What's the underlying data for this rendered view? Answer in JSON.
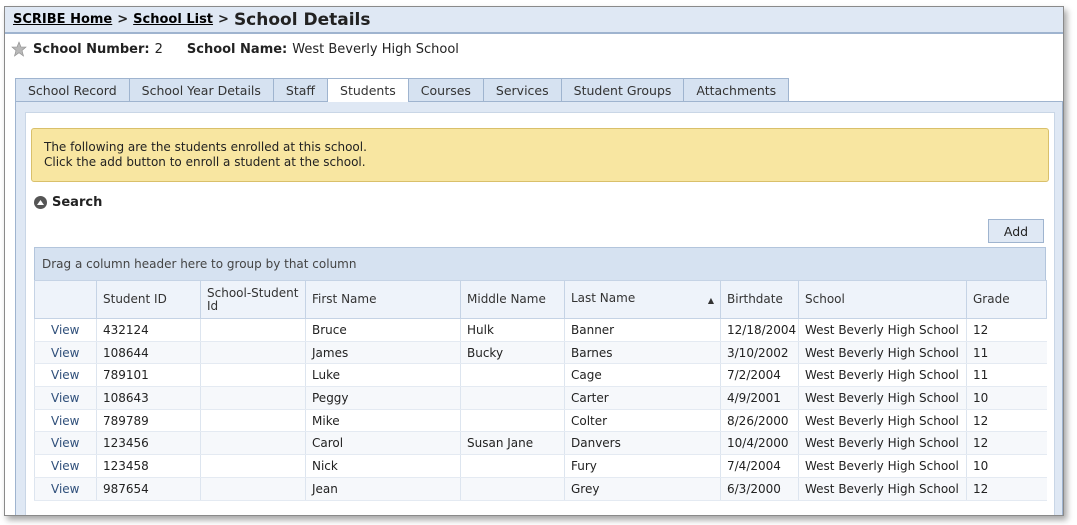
{
  "breadcrumb": {
    "home": "SCRIBE Home",
    "list": "School List",
    "current": "School Details",
    "sep1": ">",
    "sep2": ">"
  },
  "school": {
    "number_label": "School Number:",
    "number": "2",
    "name_label": "School Name:",
    "name": "West Beverly High School"
  },
  "tabs": [
    "School Record",
    "School Year Details",
    "Staff",
    "Students",
    "Courses",
    "Services",
    "Student Groups",
    "Attachments"
  ],
  "active_tab": "Students",
  "notice": {
    "line1": "The following are the students enrolled at this school.",
    "line2": "Click the add button to enroll a student at the school."
  },
  "search": {
    "label": "Search"
  },
  "add_button": "Add",
  "grid": {
    "group_hint": "Drag a column header here to group by that column",
    "columns": [
      "",
      "Student ID",
      "School-Student Id",
      "First Name",
      "Middle Name",
      "Last Name",
      "Birthdate",
      "School",
      "Grade"
    ],
    "sorted_column": "Last Name",
    "view_label": "View",
    "rows": [
      {
        "student_id": "432124",
        "school_student_id": "",
        "first": "Bruce",
        "middle": "Hulk",
        "last": "Banner",
        "birthdate": "12/18/2004",
        "school": "West Beverly High School",
        "grade": "12"
      },
      {
        "student_id": "108644",
        "school_student_id": "",
        "first": "James",
        "middle": "Bucky",
        "last": "Barnes",
        "birthdate": "3/10/2002",
        "school": "West Beverly High School",
        "grade": "11"
      },
      {
        "student_id": "789101",
        "school_student_id": "",
        "first": "Luke",
        "middle": "",
        "last": "Cage",
        "birthdate": "7/2/2004",
        "school": "West Beverly High School",
        "grade": "11"
      },
      {
        "student_id": "108643",
        "school_student_id": "",
        "first": "Peggy",
        "middle": "",
        "last": "Carter",
        "birthdate": "4/9/2001",
        "school": "West Beverly High School",
        "grade": "10"
      },
      {
        "student_id": "789789",
        "school_student_id": "",
        "first": "Mike",
        "middle": "",
        "last": "Colter",
        "birthdate": "8/26/2000",
        "school": "West Beverly High School",
        "grade": "12"
      },
      {
        "student_id": "123456",
        "school_student_id": "",
        "first": "Carol",
        "middle": "Susan Jane",
        "last": "Danvers",
        "birthdate": "10/4/2000",
        "school": "West Beverly High School",
        "grade": "12"
      },
      {
        "student_id": "123458",
        "school_student_id": "",
        "first": "Nick",
        "middle": "",
        "last": "Fury",
        "birthdate": "7/4/2004",
        "school": "West Beverly High School",
        "grade": "10"
      },
      {
        "student_id": "987654",
        "school_student_id": "",
        "first": "Jean",
        "middle": "",
        "last": "Grey",
        "birthdate": "6/3/2000",
        "school": "West Beverly High School",
        "grade": "12"
      }
    ]
  }
}
